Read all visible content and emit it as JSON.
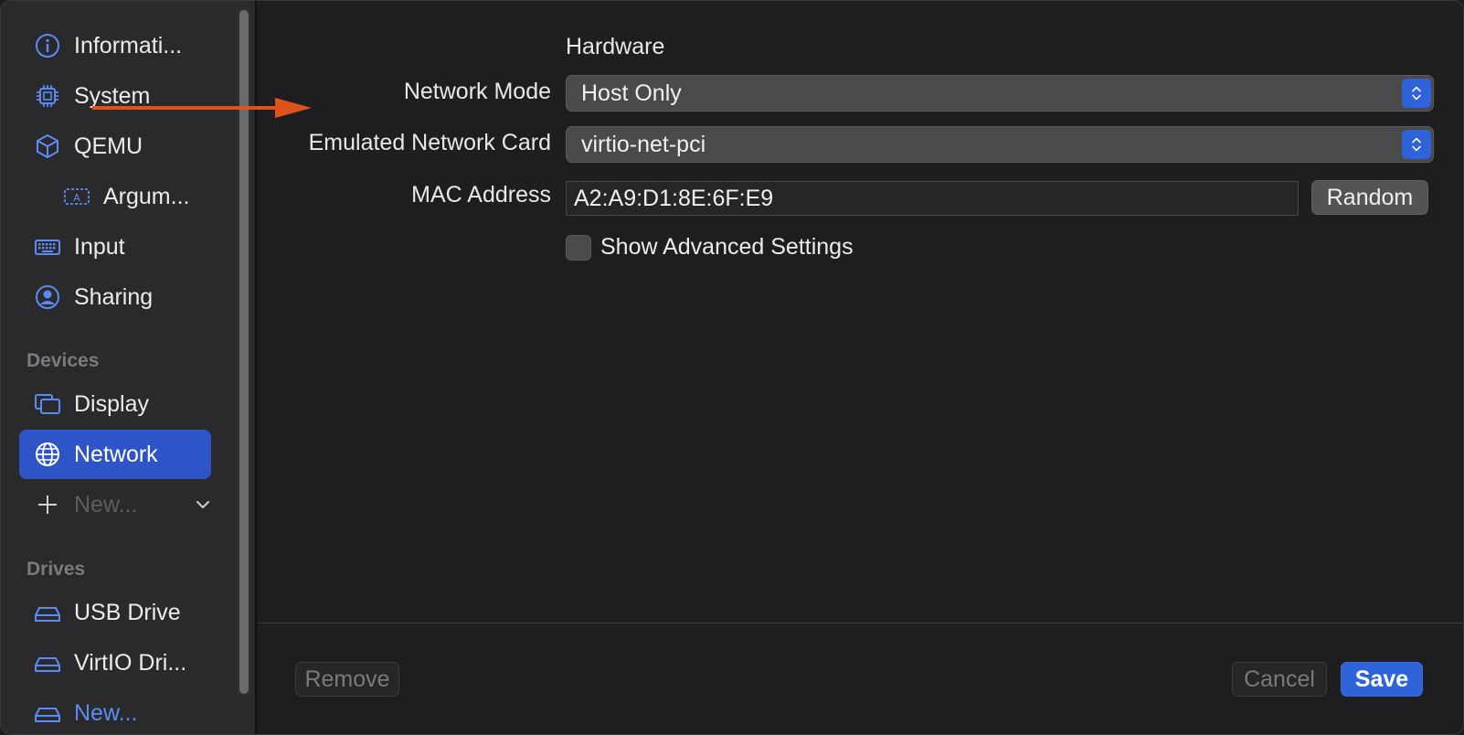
{
  "sidebar": {
    "items": [
      {
        "label": "Informati...",
        "icon": "info-icon"
      },
      {
        "label": "System",
        "icon": "cpu-icon"
      },
      {
        "label": "QEMU",
        "icon": "cube-icon"
      },
      {
        "label": "Argum...",
        "icon": "text-field-icon"
      },
      {
        "label": "Input",
        "icon": "keyboard-icon"
      },
      {
        "label": "Sharing",
        "icon": "person-circle-icon"
      }
    ],
    "devices_label": "Devices",
    "devices": [
      {
        "label": "Display",
        "icon": "display-icon"
      },
      {
        "label": "Network",
        "icon": "globe-icon",
        "active": true
      },
      {
        "label": "New...",
        "icon": "plus-icon"
      }
    ],
    "drives_label": "Drives",
    "drives": [
      {
        "label": "USB Drive",
        "icon": "drive-icon"
      },
      {
        "label": "VirtIO Dri...",
        "icon": "drive-icon"
      },
      {
        "label": "New...",
        "icon": "drive-add-icon"
      }
    ]
  },
  "main": {
    "section_title": "Hardware",
    "network_mode": {
      "label": "Network Mode",
      "value": "Host Only"
    },
    "network_card": {
      "label": "Emulated Network Card",
      "value": "virtio-net-pci"
    },
    "mac_address": {
      "label": "MAC Address",
      "value": "A2:A9:D1:8E:6F:E9",
      "random_label": "Random"
    },
    "advanced": {
      "label": "Show Advanced Settings",
      "checked": false
    }
  },
  "footer": {
    "remove_label": "Remove",
    "cancel_label": "Cancel",
    "save_label": "Save"
  },
  "colors": {
    "accent": "#2f63d9",
    "sidebar_active": "#2d55c8",
    "icon_blue": "#5b8cf5",
    "annotation_arrow": "#e0521c"
  }
}
